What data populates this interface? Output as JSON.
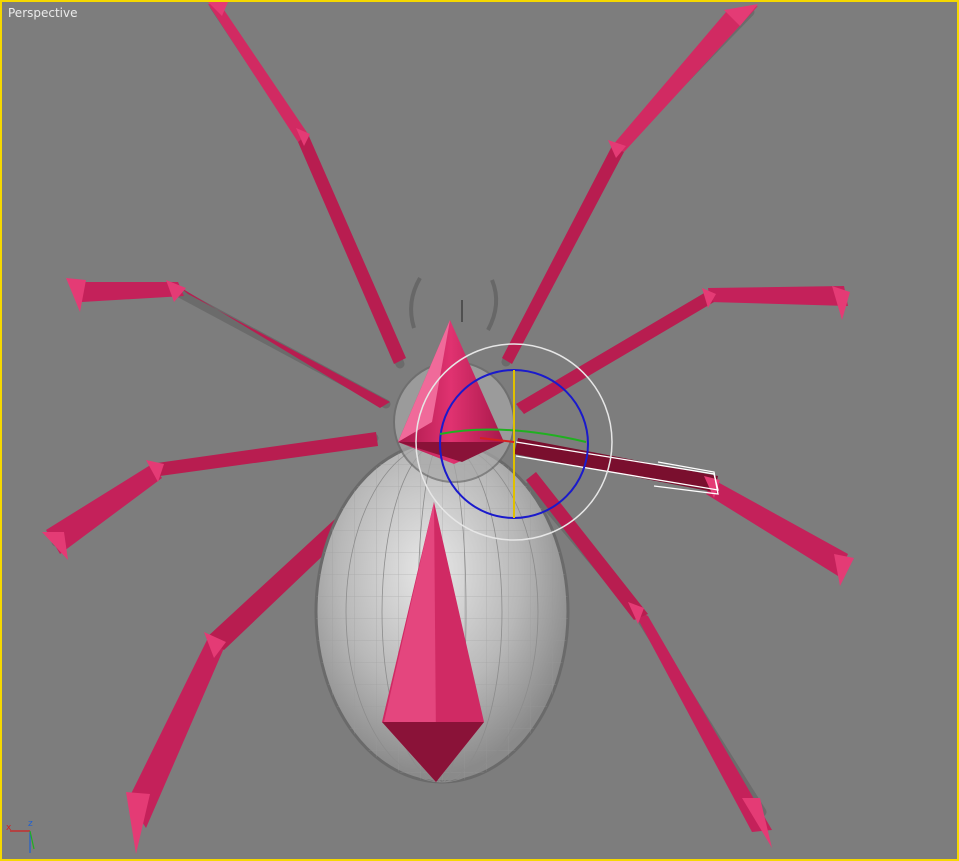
{
  "viewport": {
    "label": "Perspective",
    "active_border_color": "#f5d800",
    "background_color": "#7d7d7d"
  },
  "model": {
    "name": "spider",
    "body_color": "#c8245c",
    "dark_shade": "#8a1238",
    "abdomen_color": "#b8b8b8",
    "hair_color": "#5a5a5a"
  },
  "gizmo": {
    "type": "rotate-gizmo",
    "outer_ring_color": "#e6e6e6",
    "screen_ring_color": "#1a1acc",
    "x_axis_color": "#d42020",
    "y_axis_color": "#20b020",
    "z_axis_color": "#e0c000"
  },
  "axis_tripod": {
    "x_label": "x",
    "z_label": "z",
    "x_color": "#d42020",
    "y_color": "#20b020",
    "z_color": "#2060d0"
  }
}
